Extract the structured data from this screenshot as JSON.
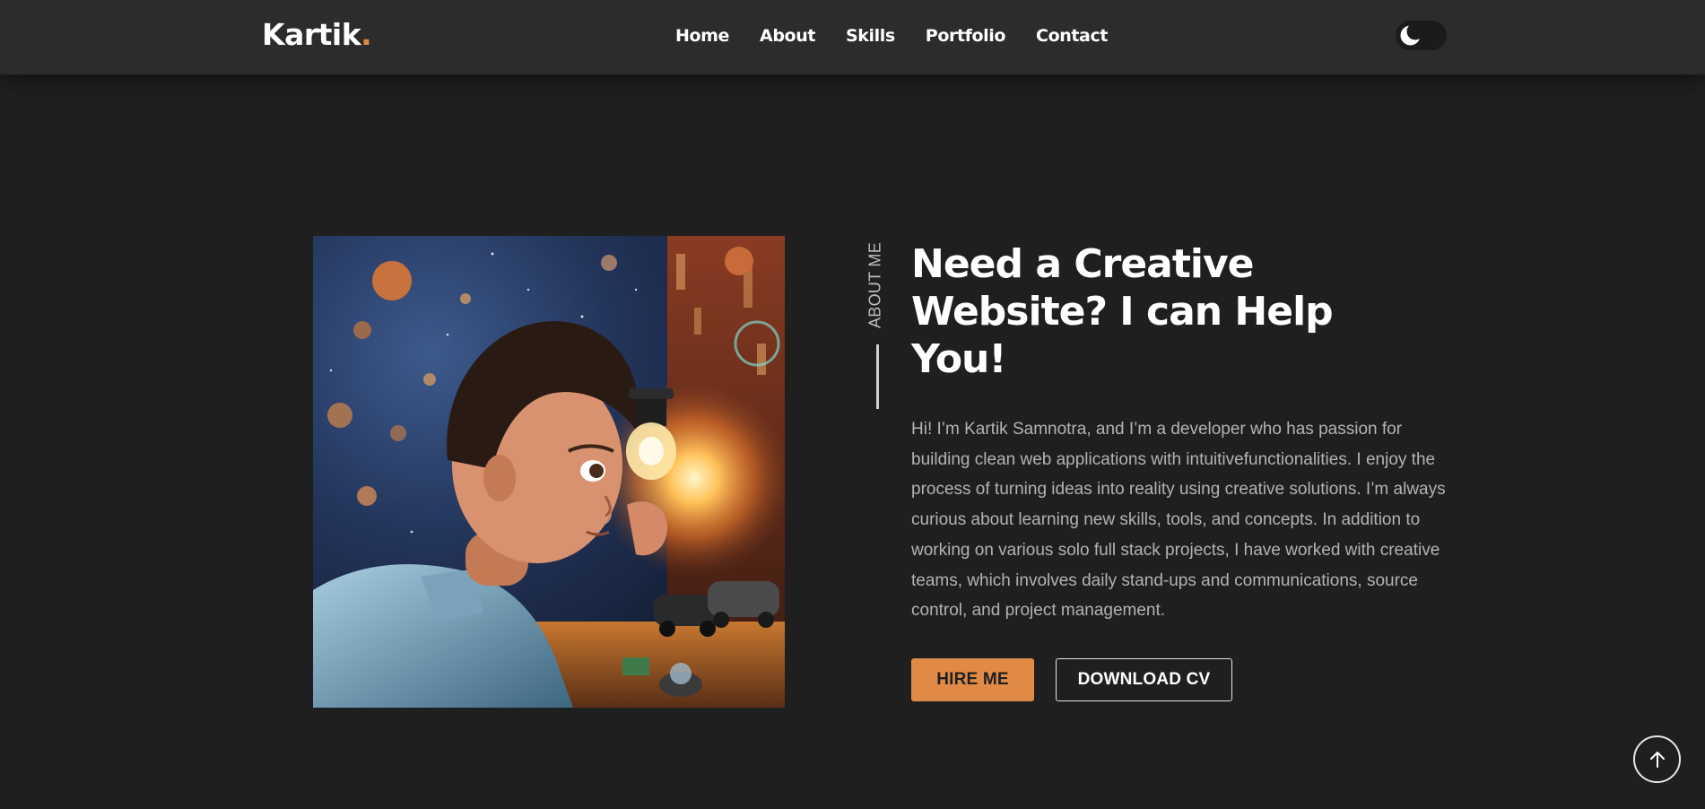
{
  "header": {
    "logo_text": "Kartik",
    "logo_dot": ".",
    "nav": [
      {
        "label": "Home"
      },
      {
        "label": "About"
      },
      {
        "label": "Skills"
      },
      {
        "label": "Portfolio"
      },
      {
        "label": "Contact"
      }
    ],
    "theme_toggle_icon": "moon-icon"
  },
  "about": {
    "section_label": "ABOUT ME",
    "headline": "Need a Creative Website? I can Help You!",
    "bio": "Hi! I’m Kartik Samnotra, and I’m a developer who has passion for building clean web applications with intuitivefunctionalities. I enjoy the process of turning ideas into reality using creative solutions. I’m always curious about learning new skills, tools, and concepts. In addition to working on various solo full stack projects, I have worked with creative teams, which involves daily stand-ups and communications, source control, and project management.",
    "hire_button": "HIRE ME",
    "download_button": "DOWNLOAD CV",
    "image_icon": "boy-with-lightbulb-illustration"
  },
  "scroll_top_icon": "arrow-up-icon",
  "colors": {
    "background": "#1f1f1f",
    "header": "#2c2c2c",
    "accent": "#e08a45",
    "body_text": "#b3b3b3"
  }
}
